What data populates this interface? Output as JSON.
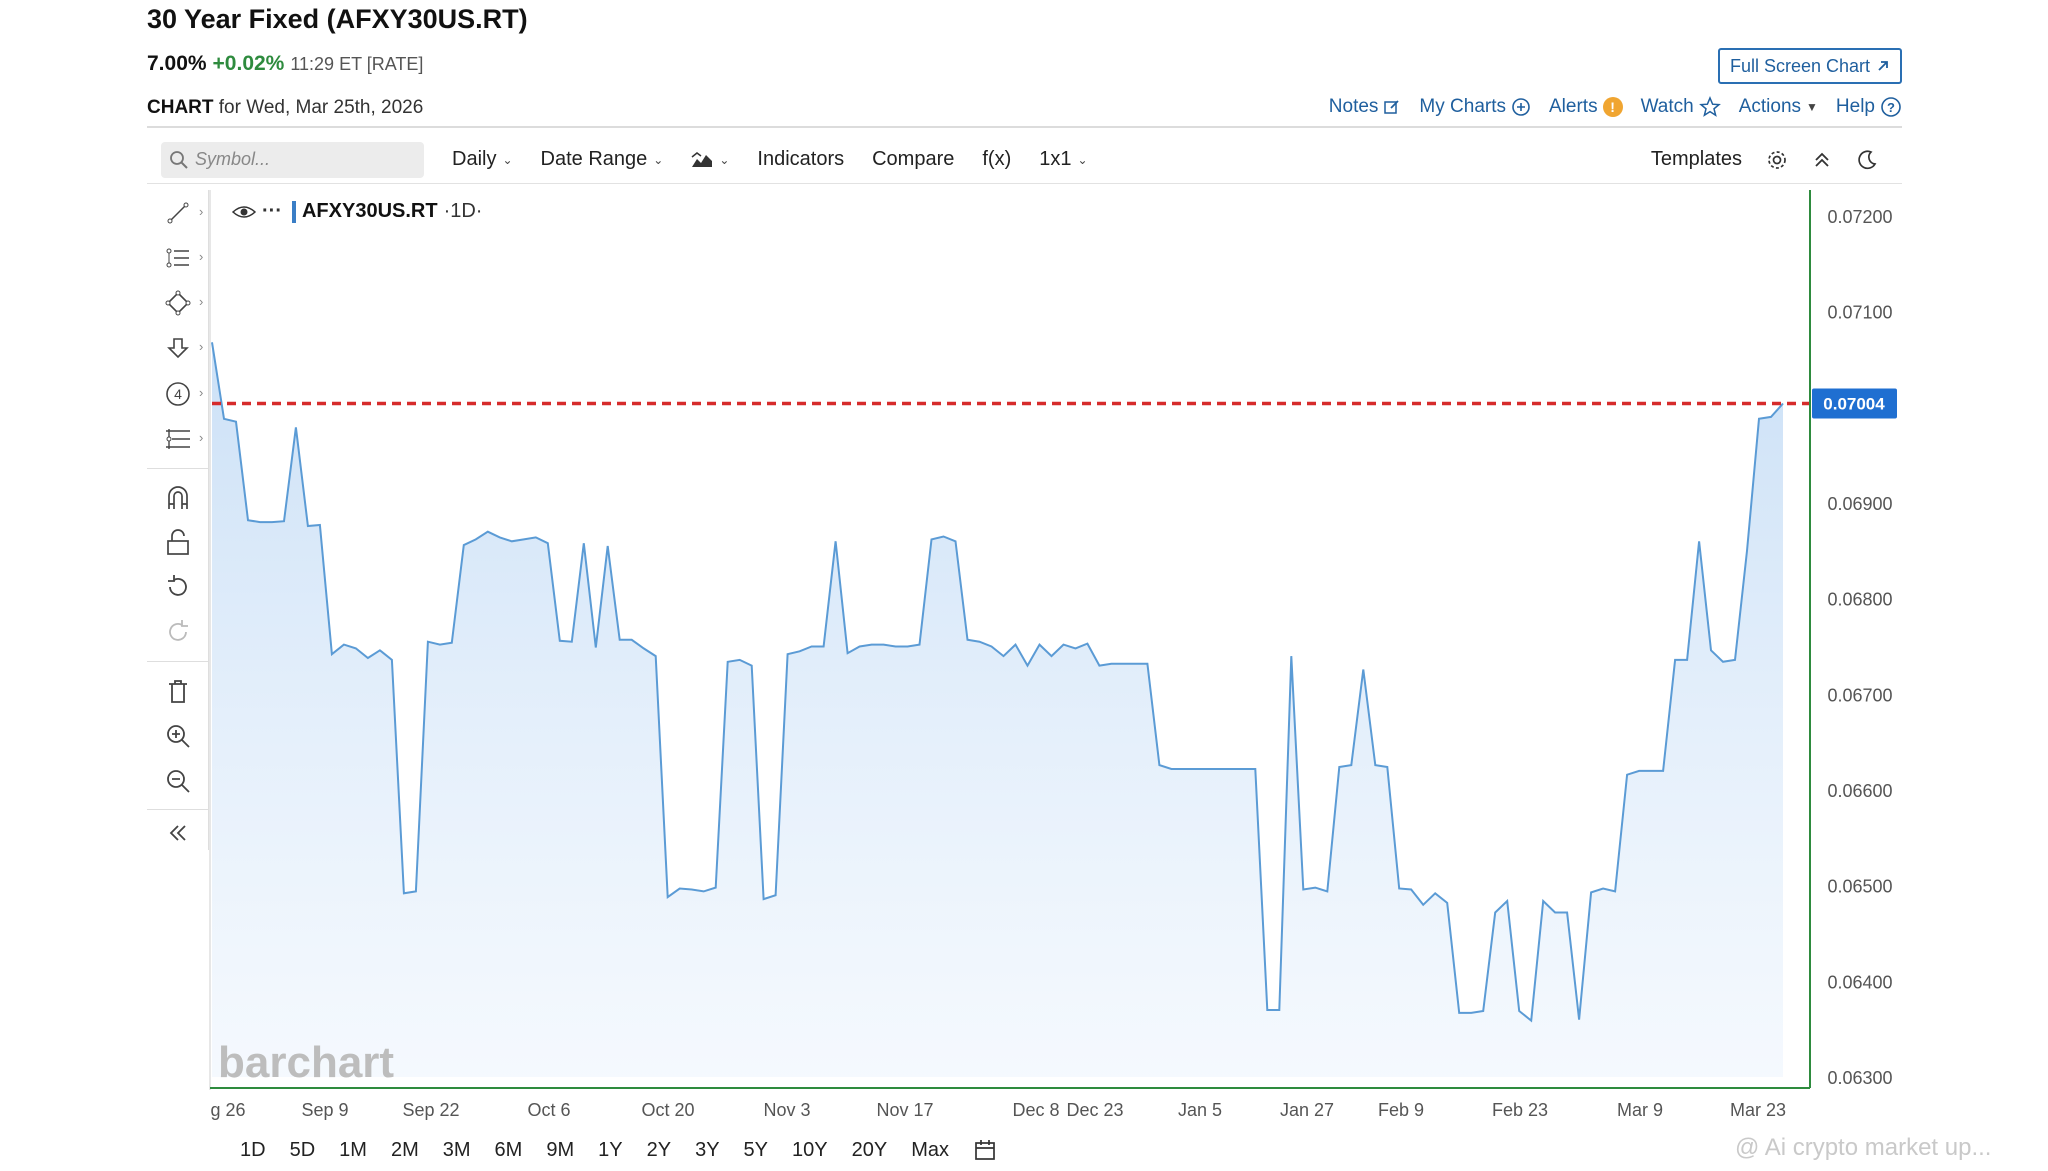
{
  "header": {
    "title": "30 Year Fixed (AFXY30US.RT)",
    "last": "7.00%",
    "change": "+0.02%",
    "time": "11:29 ET [RATE]",
    "fullscreen_label": "Full Screen Chart",
    "chart_label": "CHART",
    "chart_date": "for Wed, Mar 25th, 2026"
  },
  "toplinks": {
    "notes": "Notes",
    "my_charts": "My Charts",
    "alerts": "Alerts",
    "watch": "Watch",
    "actions": "Actions",
    "help": "Help"
  },
  "toolbar": {
    "search_placeholder": "Symbol...",
    "interval": "Daily",
    "date_range": "Date Range",
    "indicators": "Indicators",
    "compare": "Compare",
    "fx": "f(x)",
    "layout": "1x1",
    "templates": "Templates"
  },
  "legend": {
    "symbol": "AFXY30US.RT",
    "period": "·1D·"
  },
  "branding": {
    "logo": "barchart"
  },
  "range_buttons": [
    "1D",
    "5D",
    "1M",
    "2M",
    "3M",
    "6M",
    "9M",
    "1Y",
    "2Y",
    "3Y",
    "5Y",
    "10Y",
    "20Y",
    "Max"
  ],
  "watermark": "@ Ai crypto market up...",
  "colors": {
    "line": "#5b9bd5",
    "fill_top": "#c9dff6",
    "last_price_line": "#d62b2b",
    "price_tag_bg": "#1f6fd1",
    "axis_line": "#2e8b3e",
    "link": "#1f5f9e"
  },
  "icons": {
    "left_toolbar": [
      "trendline-icon",
      "fib-icon",
      "shape-icon",
      "arrow-icon",
      "count-icon",
      "measure-icon",
      "magnet-icon",
      "lock-icon",
      "undo-icon",
      "redo-icon",
      "trash-icon",
      "zoom-in-icon",
      "zoom-out-icon",
      "collapse-icon"
    ]
  },
  "chart_data": {
    "type": "line",
    "series": [
      {
        "values": [
          0.07068,
          0.06988,
          0.06985,
          0.06882,
          0.0688,
          0.0688,
          0.06881,
          0.06979,
          0.06876,
          0.06877,
          0.06742,
          0.06752,
          0.06748,
          0.06738,
          0.06746,
          0.06736,
          0.06492,
          0.06494,
          0.06755,
          0.06752,
          0.06754,
          0.06856,
          0.06862,
          0.0687,
          0.06864,
          0.0686,
          0.06862,
          0.06864,
          0.06858,
          0.06756,
          0.06755,
          0.06858,
          0.06749,
          0.06855,
          0.06757,
          0.06757,
          0.06748,
          0.0674,
          0.06488,
          0.06497,
          0.06496,
          0.06494,
          0.06498,
          0.06734,
          0.06736,
          0.0673,
          0.06486,
          0.0649,
          0.06742,
          0.06745,
          0.0675,
          0.0675,
          0.0686,
          0.06743,
          0.0675,
          0.06752,
          0.06752,
          0.0675,
          0.0675,
          0.06752,
          0.06862,
          0.06865,
          0.0686,
          0.06757,
          0.06755,
          0.0675,
          0.0674,
          0.06752,
          0.0673,
          0.06752,
          0.0674,
          0.06752,
          0.06748,
          0.06753,
          0.0673,
          0.06732,
          0.06732,
          0.06732,
          0.06732,
          0.06626,
          0.06622,
          0.06622,
          0.06622,
          0.06622,
          0.06622,
          0.06622,
          0.06622,
          0.06622,
          0.0637,
          0.0637,
          0.0674,
          0.06496,
          0.06498,
          0.06494,
          0.06624,
          0.06626,
          0.06726,
          0.06626,
          0.06624,
          0.06497,
          0.06496,
          0.0648,
          0.06492,
          0.06482,
          0.06367,
          0.06367,
          0.06369,
          0.06472,
          0.06484,
          0.06369,
          0.06359,
          0.06484,
          0.06472,
          0.06472,
          0.0636,
          0.06493,
          0.06497,
          0.06494,
          0.06616,
          0.0662,
          0.0662,
          0.0662,
          0.06736,
          0.06736,
          0.0686,
          0.06746,
          0.06734,
          0.06736,
          0.0685,
          0.06988,
          0.0699,
          0.07004
        ]
      }
    ],
    "x_tick_labels": [
      "g 26",
      "Sep 9",
      "Sep 22",
      "Oct 6",
      "Oct 20",
      "Nov 3",
      "Nov 17",
      "Dec 8",
      "Dec 23",
      "Jan 5",
      "Jan 27",
      "Feb 9",
      "Feb 23",
      "Mar 9",
      "Mar 23"
    ],
    "y_tick_labels": [
      "0.07200",
      "0.07100",
      "0.07004",
      "0.06900",
      "0.06800",
      "0.06700",
      "0.06600",
      "0.06500",
      "0.06400",
      "0.06300"
    ],
    "ylim": [
      0.063,
      0.072
    ],
    "last_value": 0.07004,
    "last_value_label": "0.07004",
    "grid": false
  }
}
